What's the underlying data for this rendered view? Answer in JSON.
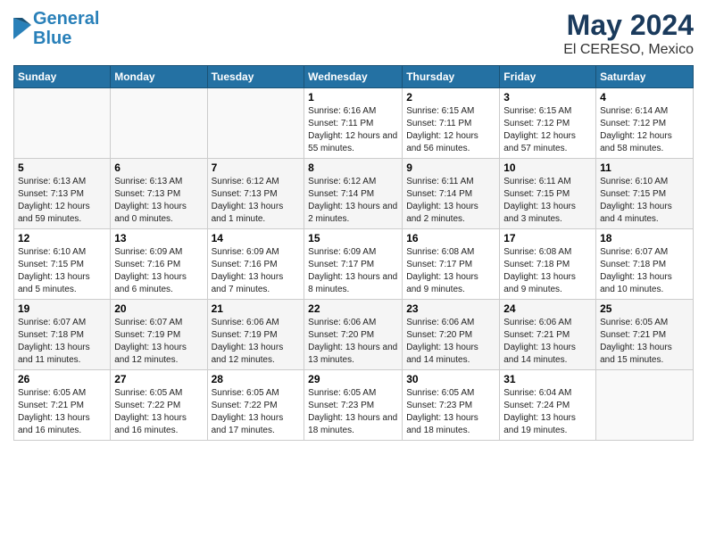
{
  "logo": {
    "line1": "General",
    "line2": "Blue"
  },
  "title": {
    "month": "May 2024",
    "location": "El CERESO, Mexico"
  },
  "weekdays": [
    "Sunday",
    "Monday",
    "Tuesday",
    "Wednesday",
    "Thursday",
    "Friday",
    "Saturday"
  ],
  "weeks": [
    [
      {
        "day": "",
        "info": ""
      },
      {
        "day": "",
        "info": ""
      },
      {
        "day": "",
        "info": ""
      },
      {
        "day": "1",
        "info": "Sunrise: 6:16 AM\nSunset: 7:11 PM\nDaylight: 12 hours\nand 55 minutes."
      },
      {
        "day": "2",
        "info": "Sunrise: 6:15 AM\nSunset: 7:11 PM\nDaylight: 12 hours\nand 56 minutes."
      },
      {
        "day": "3",
        "info": "Sunrise: 6:15 AM\nSunset: 7:12 PM\nDaylight: 12 hours\nand 57 minutes."
      },
      {
        "day": "4",
        "info": "Sunrise: 6:14 AM\nSunset: 7:12 PM\nDaylight: 12 hours\nand 58 minutes."
      }
    ],
    [
      {
        "day": "5",
        "info": "Sunrise: 6:13 AM\nSunset: 7:13 PM\nDaylight: 12 hours\nand 59 minutes."
      },
      {
        "day": "6",
        "info": "Sunrise: 6:13 AM\nSunset: 7:13 PM\nDaylight: 13 hours\nand 0 minutes."
      },
      {
        "day": "7",
        "info": "Sunrise: 6:12 AM\nSunset: 7:13 PM\nDaylight: 13 hours\nand 1 minute."
      },
      {
        "day": "8",
        "info": "Sunrise: 6:12 AM\nSunset: 7:14 PM\nDaylight: 13 hours\nand 2 minutes."
      },
      {
        "day": "9",
        "info": "Sunrise: 6:11 AM\nSunset: 7:14 PM\nDaylight: 13 hours\nand 2 minutes."
      },
      {
        "day": "10",
        "info": "Sunrise: 6:11 AM\nSunset: 7:15 PM\nDaylight: 13 hours\nand 3 minutes."
      },
      {
        "day": "11",
        "info": "Sunrise: 6:10 AM\nSunset: 7:15 PM\nDaylight: 13 hours\nand 4 minutes."
      }
    ],
    [
      {
        "day": "12",
        "info": "Sunrise: 6:10 AM\nSunset: 7:15 PM\nDaylight: 13 hours\nand 5 minutes."
      },
      {
        "day": "13",
        "info": "Sunrise: 6:09 AM\nSunset: 7:16 PM\nDaylight: 13 hours\nand 6 minutes."
      },
      {
        "day": "14",
        "info": "Sunrise: 6:09 AM\nSunset: 7:16 PM\nDaylight: 13 hours\nand 7 minutes."
      },
      {
        "day": "15",
        "info": "Sunrise: 6:09 AM\nSunset: 7:17 PM\nDaylight: 13 hours\nand 8 minutes."
      },
      {
        "day": "16",
        "info": "Sunrise: 6:08 AM\nSunset: 7:17 PM\nDaylight: 13 hours\nand 9 minutes."
      },
      {
        "day": "17",
        "info": "Sunrise: 6:08 AM\nSunset: 7:18 PM\nDaylight: 13 hours\nand 9 minutes."
      },
      {
        "day": "18",
        "info": "Sunrise: 6:07 AM\nSunset: 7:18 PM\nDaylight: 13 hours\nand 10 minutes."
      }
    ],
    [
      {
        "day": "19",
        "info": "Sunrise: 6:07 AM\nSunset: 7:18 PM\nDaylight: 13 hours\nand 11 minutes."
      },
      {
        "day": "20",
        "info": "Sunrise: 6:07 AM\nSunset: 7:19 PM\nDaylight: 13 hours\nand 12 minutes."
      },
      {
        "day": "21",
        "info": "Sunrise: 6:06 AM\nSunset: 7:19 PM\nDaylight: 13 hours\nand 12 minutes."
      },
      {
        "day": "22",
        "info": "Sunrise: 6:06 AM\nSunset: 7:20 PM\nDaylight: 13 hours\nand 13 minutes."
      },
      {
        "day": "23",
        "info": "Sunrise: 6:06 AM\nSunset: 7:20 PM\nDaylight: 13 hours\nand 14 minutes."
      },
      {
        "day": "24",
        "info": "Sunrise: 6:06 AM\nSunset: 7:21 PM\nDaylight: 13 hours\nand 14 minutes."
      },
      {
        "day": "25",
        "info": "Sunrise: 6:05 AM\nSunset: 7:21 PM\nDaylight: 13 hours\nand 15 minutes."
      }
    ],
    [
      {
        "day": "26",
        "info": "Sunrise: 6:05 AM\nSunset: 7:21 PM\nDaylight: 13 hours\nand 16 minutes."
      },
      {
        "day": "27",
        "info": "Sunrise: 6:05 AM\nSunset: 7:22 PM\nDaylight: 13 hours\nand 16 minutes."
      },
      {
        "day": "28",
        "info": "Sunrise: 6:05 AM\nSunset: 7:22 PM\nDaylight: 13 hours\nand 17 minutes."
      },
      {
        "day": "29",
        "info": "Sunrise: 6:05 AM\nSunset: 7:23 PM\nDaylight: 13 hours\nand 18 minutes."
      },
      {
        "day": "30",
        "info": "Sunrise: 6:05 AM\nSunset: 7:23 PM\nDaylight: 13 hours\nand 18 minutes."
      },
      {
        "day": "31",
        "info": "Sunrise: 6:04 AM\nSunset: 7:24 PM\nDaylight: 13 hours\nand 19 minutes."
      },
      {
        "day": "",
        "info": ""
      }
    ]
  ]
}
